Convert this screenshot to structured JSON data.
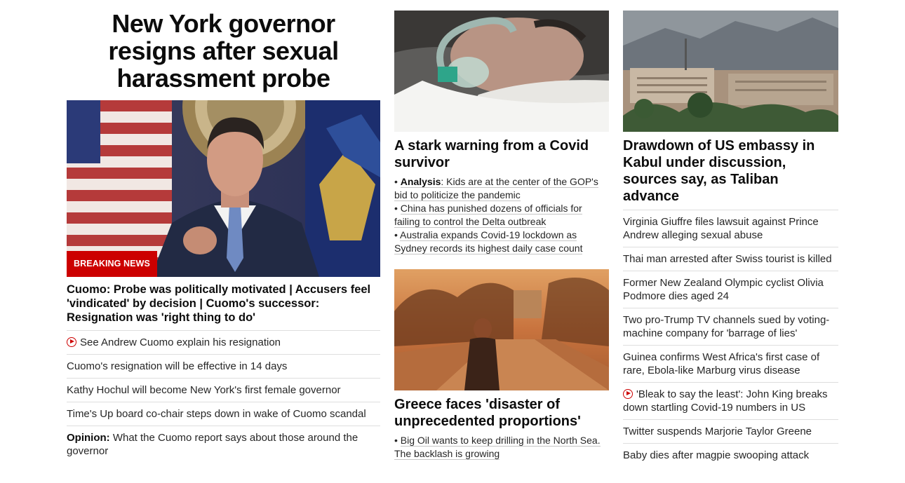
{
  "main_story": {
    "headline": "New York governor resigns after sexual harassment probe",
    "badge": "BREAKING NEWS",
    "lead": "Cuomo: Probe was politically motivated | Accusers feel 'vindicated' by decision | Cuomo's successor: Resignation was 'right thing to do'",
    "items": [
      {
        "text": "See Andrew Cuomo explain his resignation",
        "video": true
      },
      {
        "text": "Cuomo's resignation will be effective in 14 days"
      },
      {
        "text": "Kathy Hochul will become New York's first female governor"
      },
      {
        "text": "Time's Up board co-chair steps down in wake of Cuomo scandal"
      }
    ],
    "opinion_kicker": "Opinion:",
    "opinion_text": " What the Cuomo report says about those around the governor"
  },
  "covid_story": {
    "title": "A stark warning from a Covid survivor",
    "analysis_kicker": "Analysis",
    "analysis_text": ": Kids are at the center of the GOP's bid to politicize the pandemic",
    "sub2": "China has punished dozens of officials for failing to control the Delta outbreak",
    "sub3": "Australia expands Covid-19 lockdown as Sydney records its highest daily case count"
  },
  "greece_story": {
    "title": "Greece faces 'disaster of unprecedented proportions'",
    "sub1": "Big Oil wants to keep drilling in the North Sea. The backlash is growing"
  },
  "kabul_story": {
    "title": "Drawdown of US embassy in Kabul under discussion, sources say, as Taliban advance",
    "items": [
      {
        "text": "Virginia Giuffre files lawsuit against Prince Andrew alleging sexual abuse"
      },
      {
        "text": "Thai man arrested after Swiss tourist is killed"
      },
      {
        "text": "Former New Zealand Olympic cyclist Olivia Podmore dies aged 24"
      },
      {
        "text": "Two pro-Trump TV channels sued by voting-machine company for 'barrage of lies'"
      },
      {
        "text": "Guinea confirms West Africa's first case of rare, Ebola-like Marburg virus disease"
      },
      {
        "text": "'Bleak to say the least': John King breaks down startling Covid-19 numbers in US",
        "video": true
      },
      {
        "text": "Twitter suspends Marjorie Taylor Greene"
      },
      {
        "text": "Baby dies after magpie swooping attack"
      }
    ]
  },
  "icons": {
    "video": "play-circle-icon"
  },
  "colors": {
    "breaking": "#cc0000",
    "text": "#262626",
    "divider": "#dedede"
  }
}
